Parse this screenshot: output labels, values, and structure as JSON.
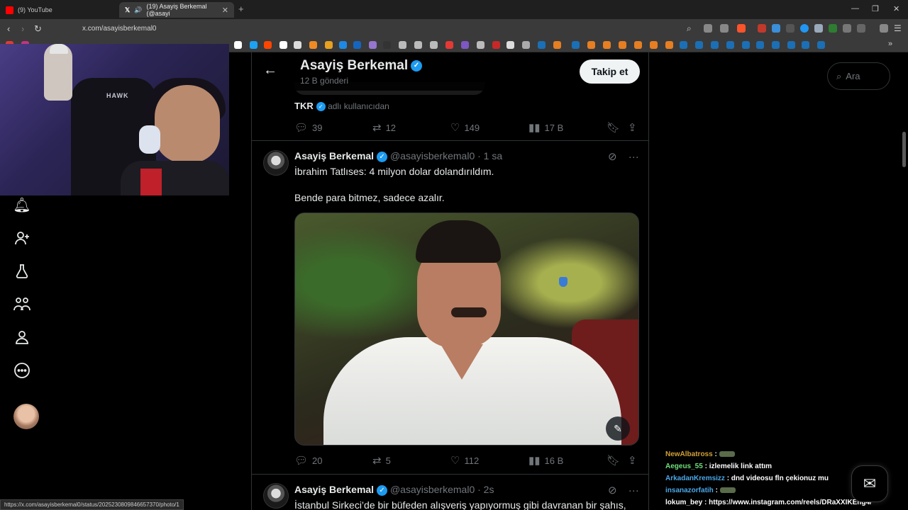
{
  "browser": {
    "tabs": [
      {
        "title": "(9) YouTube",
        "color": "#ff0000"
      },
      {
        "title": "(19) Asayiş Berkemal (@asayi",
        "color": "#ffffff"
      }
    ],
    "new_tab": "+",
    "url": "x.com/asayisberkemal0",
    "status_url": "https://x.com/asayisberkemal0/status/2025230809846657370/photo/1"
  },
  "profile_header": {
    "name": "Asayiş Berkemal",
    "posts_count": "12 B gönderi",
    "follow_label": "Takip et"
  },
  "prev_tweet": {
    "quoted_user": "TKR",
    "quoted_suffix": "adlı kullanıcıdan",
    "replies": "39",
    "retweets": "12",
    "likes": "149",
    "views": "17 B"
  },
  "tweet1": {
    "name": "Asayiş Berkemal",
    "handle": "@asayisberkemal0",
    "time": "· 1 sa",
    "line1": "İbrahim Tatlıses: 4 milyon dolar dolandırıldım.",
    "line2": "Bende para bitmez, sadece azalır.",
    "replies": "20",
    "retweets": "5",
    "likes": "112",
    "views": "16 B"
  },
  "tweet2": {
    "name": "Asayiş Berkemal",
    "handle": "@asayisberkemal0",
    "time": "· 2s",
    "line1": "İstanbul Sirkeci’de bir büfeden alışveriş yapıyormuş gibi davranan bir şahıs,"
  },
  "search": {
    "placeholder": "Ara"
  },
  "chat": [
    {
      "user": "NewAlbatross",
      "text": ":"
    },
    {
      "user": "Aegeus_55",
      "text": ": izlemelik link attım"
    },
    {
      "user": "ArkadanKremsizz",
      "text": ": dnd videosu fln çekionuz mu"
    },
    {
      "user": "insanazorfatih",
      "text": ":"
    },
    {
      "user": "lokum_bey",
      "text": ": https://www.instagram.com/reels/DRaXXIKEng4/"
    }
  ],
  "icons": {
    "verified": "verified-badge-icon",
    "accent": "#1d9bf0"
  }
}
